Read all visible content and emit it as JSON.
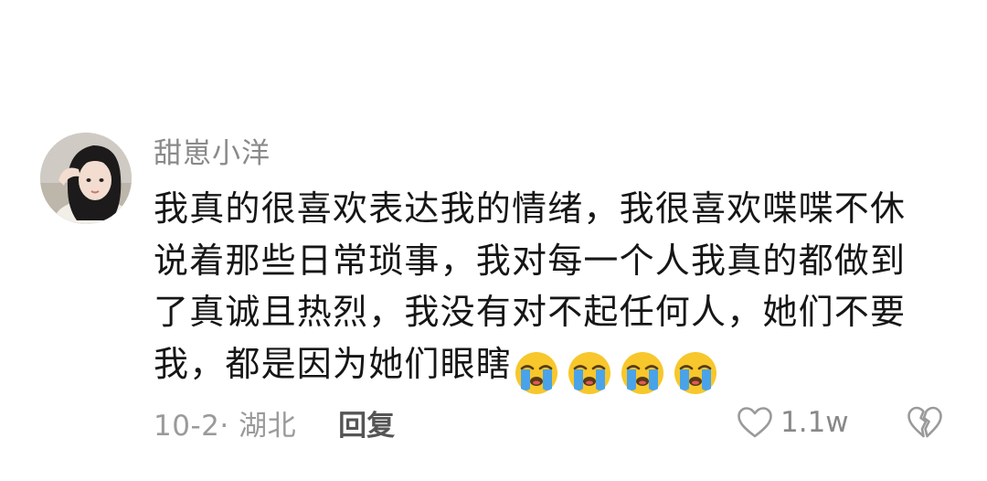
{
  "comment": {
    "username": "甜崽小洋",
    "text": "我真的很喜欢表达我的情绪，我很喜欢喋喋不休说着那些日常琐事，我对每一个人我真的都做到了真诚且热烈，我没有对不起任何人，她们不要我，都是因为她们眼瞎",
    "emojis": [
      "crying-face",
      "crying-face",
      "crying-face",
      "crying-face"
    ],
    "date_location": "10-2· 湖北",
    "reply_label": "回复",
    "like_count": "1.1w"
  },
  "colors": {
    "username": "#8a8a8a",
    "text": "#161616",
    "meta": "#9a9a9a",
    "reply": "#555555",
    "emoji_face": "#f7c72b",
    "emoji_tear": "#4aa3e8"
  },
  "icons": {
    "like": "heart-outline-icon",
    "dislike": "broken-heart-icon"
  }
}
